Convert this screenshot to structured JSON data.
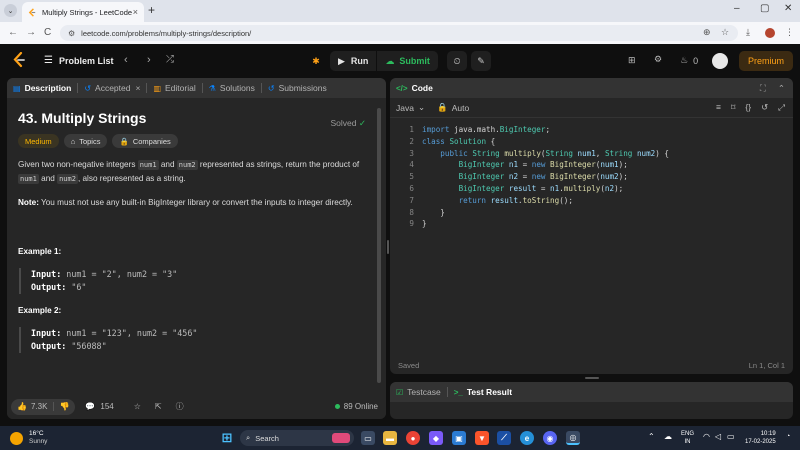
{
  "browser": {
    "tab_title": "Multiply Strings - LeetCode",
    "url": "leetcode.com/problems/multiply-strings/description/",
    "new_tab": "+",
    "back": "←",
    "forward": "→",
    "reload": "C"
  },
  "header": {
    "problem_list": "Problem List",
    "run": "Run",
    "submit": "Submit",
    "streak": "0",
    "premium": "Premium"
  },
  "left_panel": {
    "tabs": [
      "Description",
      "Accepted",
      "Editorial",
      "Solutions",
      "Submissions"
    ],
    "title": "43. Multiply Strings",
    "solved": "Solved",
    "tags": [
      "Medium",
      "Topics",
      "Companies"
    ],
    "para1_a": "Given two non-negative integers ",
    "para1_code1": "num1",
    "para1_b": " and ",
    "para1_code2": "num2",
    "para1_c": " represented as strings, return the product of ",
    "para1_code3": "num1",
    "para1_d": " and ",
    "para1_code4": "num2",
    "para1_e": ", also represented as a string.",
    "note_label": "Note:",
    "note_text": " You must not use any built-in BigInteger library or convert the inputs to integer directly.",
    "examples": [
      {
        "title": "Example 1:",
        "input_label": "Input:",
        "input": " num1 = \"2\", num2 = \"3\"",
        "output_label": "Output:",
        "output": " \"6\""
      },
      {
        "title": "Example 2:",
        "input_label": "Input:",
        "input": " num1 = \"123\", num2 = \"456\"",
        "output_label": "Output:",
        "output": " \"56088\""
      }
    ],
    "likes": "7.3K",
    "comments": "154",
    "online": "89 Online"
  },
  "code_panel": {
    "title": "Code",
    "language": "Java",
    "mode": "Auto",
    "line_numbers": [
      "1",
      "2",
      "3",
      "4",
      "5",
      "6",
      "7",
      "8",
      "9"
    ],
    "saved": "Saved",
    "cursor": "Ln 1, Col 1"
  },
  "bottom_panel": {
    "testcase": "Testcase",
    "test_result": "Test Result"
  },
  "taskbar": {
    "temp": "16°C",
    "weather": "Sunny",
    "search": "Search",
    "lang1": "ENG",
    "lang2": "IN",
    "time": "10:19",
    "date": "17-02-2025"
  },
  "colors": {
    "accent": "#ffa116",
    "green": "#2cbb5d",
    "blue": "#0a84ff"
  }
}
